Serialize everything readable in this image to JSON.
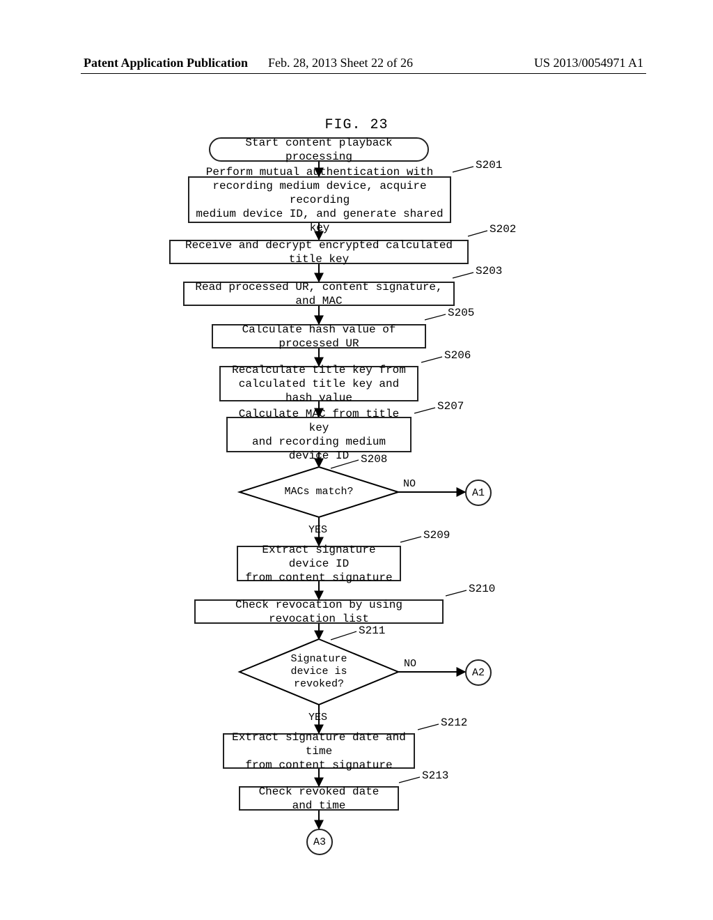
{
  "header": {
    "left": "Patent Application Publication",
    "center": "Feb. 28, 2013  Sheet 22 of 26",
    "right": "US 2013/0054971 A1"
  },
  "figure_title": "FIG. 23",
  "steps": {
    "start": "Start content playback processing",
    "s201": "Perform mutual authentication with\nrecording medium device, acquire recording\nmedium device ID, and generate shared key",
    "s202": "Receive and decrypt encrypted calculated title key",
    "s203": "Read processed UR, content signature, and MAC",
    "s205": "Calculate hash value of processed UR",
    "s206": "Recalculate title key from\ncalculated title key and hash value",
    "s207": "Calculate MAC from title key\nand recording medium device ID",
    "s208": "MACs match?",
    "s209": "Extract signature device ID\nfrom content signature",
    "s210": "Check revocation by using revocation list",
    "s211": "Signature\ndevice is\nrevoked?",
    "s212": "Extract signature date and time\nfrom content signature",
    "s213": "Check revoked date and time"
  },
  "step_labels": {
    "s201": "S201",
    "s202": "S202",
    "s203": "S203",
    "s205": "S205",
    "s206": "S206",
    "s207": "S207",
    "s208": "S208",
    "s209": "S209",
    "s210": "S210",
    "s211": "S211",
    "s212": "S212",
    "s213": "S213"
  },
  "branches": {
    "yes1": "YES",
    "no1": "NO",
    "yes2": "YES",
    "no2": "NO"
  },
  "connectors": {
    "a1": "A1",
    "a2": "A2",
    "a3": "A3"
  }
}
